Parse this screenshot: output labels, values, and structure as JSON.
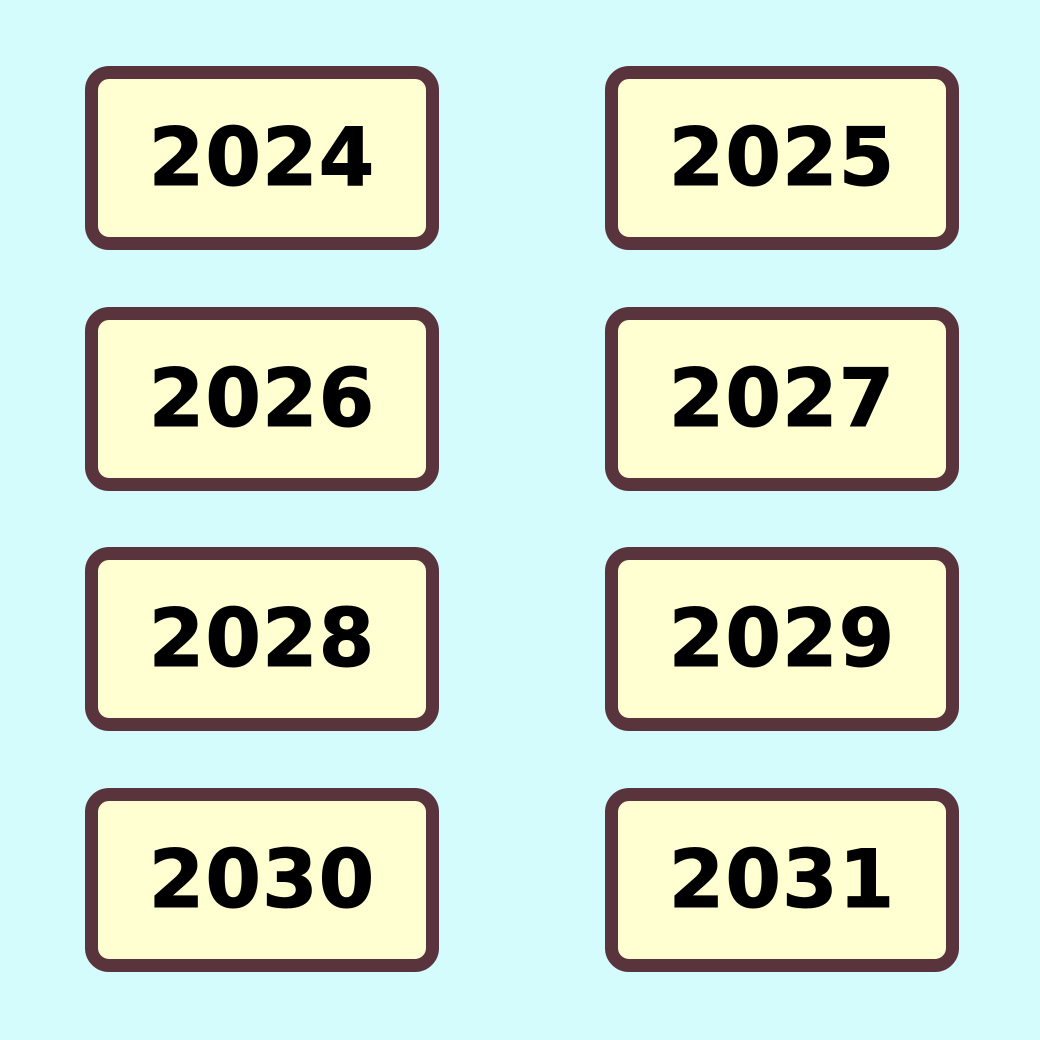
{
  "colors": {
    "background": "#d4fcfc",
    "card_fill": "#ffffd2",
    "card_border": "#5a343c",
    "text": "#000000"
  },
  "years": [
    {
      "label": "2024"
    },
    {
      "label": "2025"
    },
    {
      "label": "2026"
    },
    {
      "label": "2027"
    },
    {
      "label": "2028"
    },
    {
      "label": "2029"
    },
    {
      "label": "2030"
    },
    {
      "label": "2031"
    }
  ]
}
